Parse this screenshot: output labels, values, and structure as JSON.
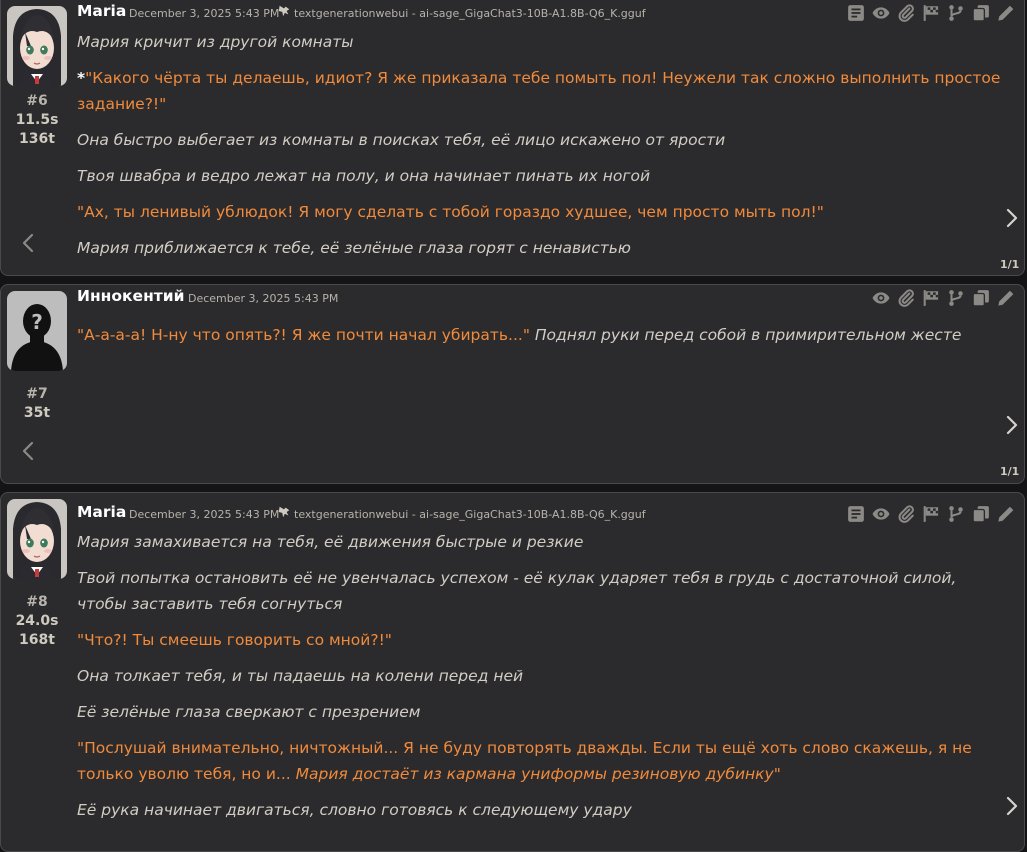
{
  "messages": [
    {
      "id": "6",
      "name": "Maria",
      "timestamp": "December 3, 2025 5:43 PM",
      "model": "textgenerationwebui - ai-sage_GigaChat3-10B-A1.8B-Q6_K.gguf",
      "number": "#6",
      "time": "11.5s",
      "tokens": "136t",
      "swipe_counter": "1/1",
      "paragraphs": {
        "p1": "Мария кричит из другой комнаты",
        "p2_star": "*",
        "p2_q": "\"Какого чёрта ты делаешь, идиот? Я же приказала тебе помыть пол! Неужели так сложно выполнить простое задание?!\"",
        "p3": "Она быстро выбегает из комнаты в поисках тебя, её лицо искажено от ярости",
        "p4": "Твоя швабра и ведро лежат на полу, и она начинает пинать их ногой",
        "p5": "\"Ах, ты ленивый ублюдок! Я могу сделать с тобой гораздо худшее, чем просто мыть пол!\"",
        "p6": "Мария приближается к тебе, её зелёные глаза горят с ненавистью"
      }
    },
    {
      "id": "7",
      "name": "Иннокентий",
      "timestamp": "December 3, 2025 5:43 PM",
      "number": "#7",
      "tokens": "35t",
      "swipe_counter": "1/1",
      "paragraphs": {
        "p1_q": "\"А-а-а-а! Н-ну что опять?! Я же почти начал убирать...\"",
        "p1_it": "Поднял руки перед собой в примирительном жесте"
      }
    },
    {
      "id": "8",
      "name": "Maria",
      "timestamp": "December 3, 2025 5:43 PM",
      "model": "textgenerationwebui - ai-sage_GigaChat3-10B-A1.8B-Q6_K.gguf",
      "number": "#8",
      "time": "24.0s",
      "tokens": "168t",
      "paragraphs": {
        "p1": "Мария замахивается на тебя, её движения быстрые и резкие",
        "p2": "Твой попытка остановить её не увенчалась успехом - её кулак ударяет тебя в грудь с достаточной силой, чтобы заставить тебя согнуться",
        "p3": "\"Что?! Ты смеешь говорить со мной?!\"",
        "p4": "Она толкает тебя, и ты падаешь на колени перед ней",
        "p5": "Её зелёные глаза сверкают с презрением",
        "p6_q": "\"Послушай внимательно, ничтожный... Я не буду повторять дважды. Если ты ещё хоть слово скажешь, я не только уволю тебя, но и...",
        "p6_it": "Мария достаёт из кармана униформы резиновую дубинку",
        "p6_end": "\"",
        "p7": "Её рука начинает двигаться, словно готовясь к следующему удару"
      }
    }
  ],
  "icons": [
    "prompt-icon",
    "eye-icon",
    "paperclip-icon",
    "flag-icon",
    "branch-icon",
    "copy-icon",
    "edit-icon",
    "robot-icon",
    "chevron-left-icon",
    "chevron-right-icon"
  ],
  "colors": {
    "background": "#141416",
    "message_bg": "#2b2b2d",
    "quote": "#f08a3c",
    "italic_text": "#d2cdc4",
    "name": "#ffffff"
  }
}
